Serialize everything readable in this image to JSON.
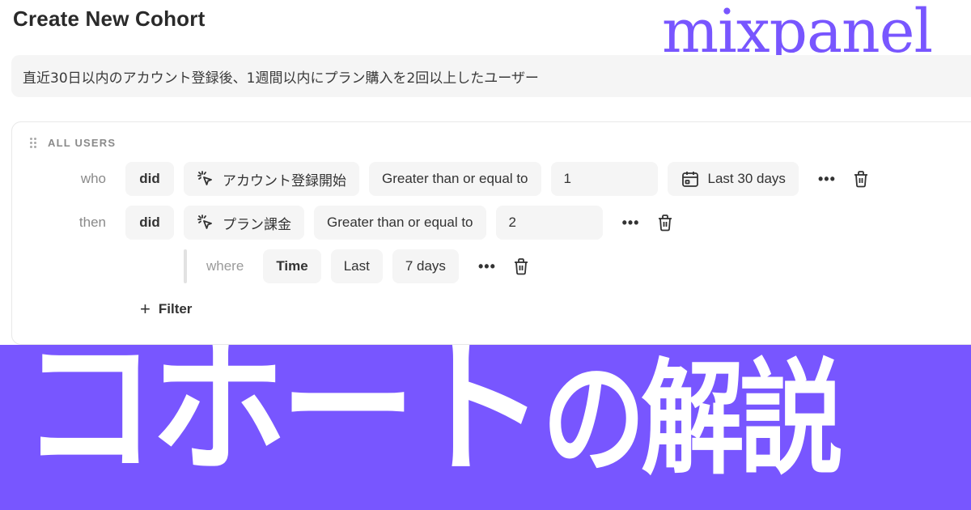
{
  "header": {
    "title": "Create New Cohort",
    "logo_text": "mixpanel",
    "brand_color": "#7856ff"
  },
  "description": {
    "value": "直近30日以内のアカウント登録後、1週間以内にプラン購入を2回以上したユーザー"
  },
  "cohort": {
    "group_label": "ALL USERS",
    "drag_icon": "drag-handle-icon",
    "rows": [
      {
        "keyword": "who",
        "verb": "did",
        "event_icon": "event-cursor-icon",
        "event": "アカウント登録開始",
        "operator": "Greater than or equal to",
        "value": "1",
        "date_icon": "calendar-icon",
        "date_range": "Last 30 days",
        "more_label": "•••",
        "delete_icon": "trash-icon"
      },
      {
        "keyword": "then",
        "verb": "did",
        "event_icon": "event-cursor-icon",
        "event": "プラン課金",
        "operator": "Greater than or equal to",
        "value": "2",
        "more_label": "•••",
        "delete_icon": "trash-icon"
      }
    ],
    "where_filter": {
      "keyword": "where",
      "property": "Time",
      "operator": "Last",
      "value": "7 days",
      "more_label": "•••",
      "delete_icon": "trash-icon"
    },
    "add_filter": {
      "icon": "plus-icon",
      "plus": "+",
      "label": "Filter"
    }
  },
  "banner": {
    "title_main": "コホート",
    "title_sub": "の解説",
    "background_color": "#7856ff"
  }
}
